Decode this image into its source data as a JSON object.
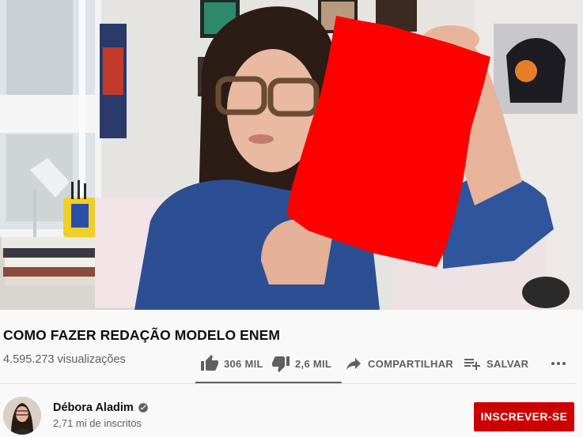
{
  "video": {
    "title": "COMO FAZER REDAÇÃO MODELO ENEM",
    "views": "4.595.273 visualizações"
  },
  "actions": {
    "like": {
      "label": "306 MIL",
      "icon": "thumb-up-icon"
    },
    "dislike": {
      "label": "2,6 MIL",
      "icon": "thumb-down-icon"
    },
    "share": {
      "label": "COMPARTILHAR",
      "icon": "share-arrow-icon"
    },
    "save": {
      "label": "SALVAR",
      "icon": "playlist-add-icon"
    },
    "more": {
      "icon": "more-horizontal-icon"
    },
    "like_ratio": 0.992
  },
  "channel": {
    "name": "Débora Aladim",
    "verified": true,
    "subscribers": "2,71 mi de inscritos",
    "subscribe_label": "INSCREVER-SE"
  },
  "colors": {
    "subscribe_bg": "#cc0000",
    "secondary_text": "#606060",
    "redacted_block": "#ff0000"
  }
}
